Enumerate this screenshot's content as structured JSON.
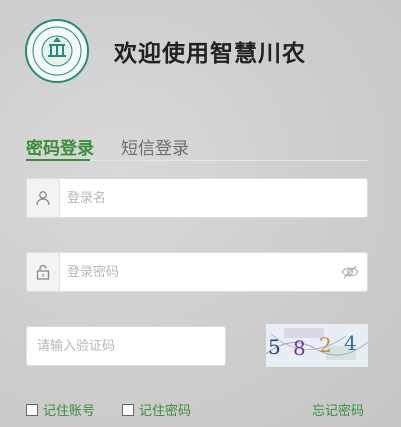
{
  "header": {
    "title": "欢迎使用智慧川农"
  },
  "tabs": [
    {
      "label": "密码登录",
      "active": true
    },
    {
      "label": "短信登录",
      "active": false
    }
  ],
  "form": {
    "username_placeholder": "登录名",
    "password_placeholder": "登录密码",
    "captcha_placeholder": "请输入验证码",
    "captcha_code": "5824"
  },
  "options": {
    "remember_account": "记住账号",
    "remember_password": "记住密码",
    "forgot_password": "忘记密码"
  },
  "colors": {
    "accent": "#3a8f3a",
    "logo": "#2a8a78"
  },
  "icons": {
    "user": "user-icon",
    "lock": "lock-icon",
    "eye": "eye-off-icon"
  }
}
